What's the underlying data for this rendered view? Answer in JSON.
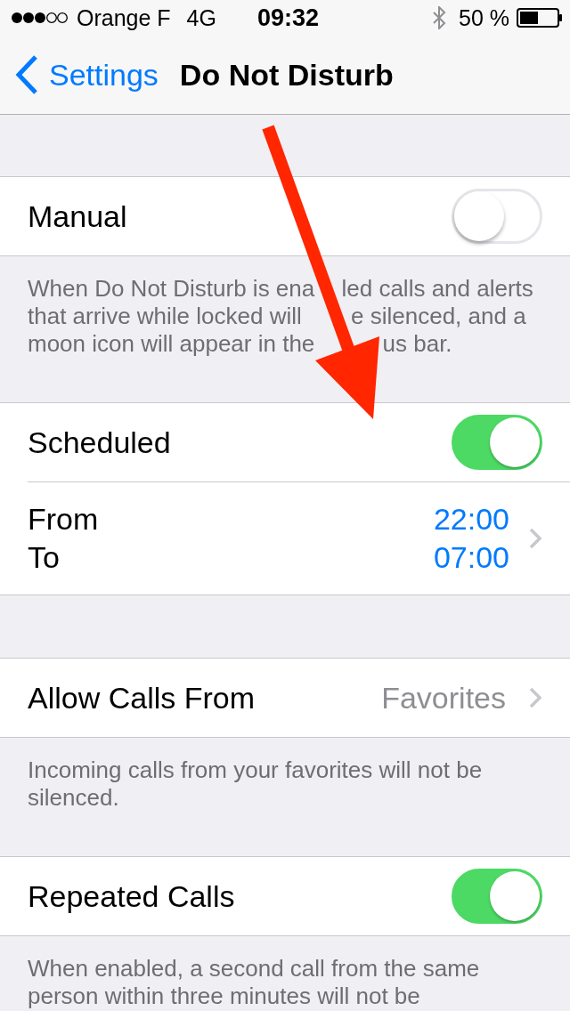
{
  "status_bar": {
    "carrier": "Orange F",
    "network": "4G",
    "time": "09:32",
    "battery": "50 %"
  },
  "nav": {
    "back": "Settings",
    "title": "Do Not Disturb"
  },
  "sections": [
    {
      "rows": [
        {
          "kind": "toggle",
          "label": "Manual",
          "on": false
        }
      ],
      "footer": [
        "When Do Not Disturb is ena",
        "led calls and alerts that arrive while locked will",
        "e silenced, and a moon icon will appear in the",
        "us bar."
      ]
    },
    {
      "rows": [
        {
          "kind": "toggle",
          "label": "Scheduled",
          "on": true
        },
        {
          "kind": "schedule",
          "from_label": "From",
          "to_label": "To",
          "from_time": "22:00",
          "to_time": "07:00"
        }
      ]
    },
    {
      "rows": [
        {
          "kind": "value",
          "label": "Allow Calls From",
          "value": "Favorites"
        }
      ],
      "footer": [
        "Incoming calls from your favorites will not be silenced."
      ]
    },
    {
      "rows": [
        {
          "kind": "toggle",
          "label": "Repeated Calls",
          "on": true
        }
      ],
      "footer": [
        "When enabled, a second call from the same person within three minutes will not be"
      ]
    }
  ],
  "annotations": [
    {
      "kind": "arrow"
    }
  ]
}
